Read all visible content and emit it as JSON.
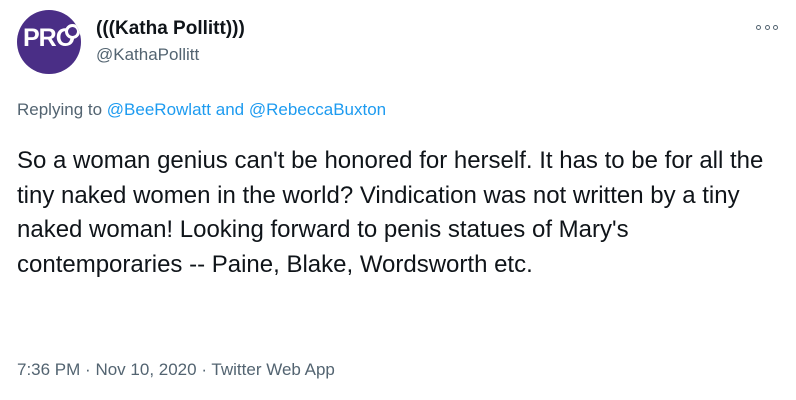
{
  "author": {
    "display_name": "(((Katha Pollitt)))",
    "handle": "@KathaPollitt",
    "avatar_text": "PRO",
    "avatar_color": "#4a2e86"
  },
  "more_icon": "more-horizontal-icon",
  "reply_context": {
    "prefix": "Replying to",
    "users": [
      "@BeeRowlatt",
      "@RebeccaBuxton"
    ],
    "conjunction": "and"
  },
  "tweet_text": "So a woman genius can't be honored for herself. It has to be for all the tiny naked women in the world? Vindication was not written by a tiny naked woman! Looking forward to penis statues of Mary's contemporaries -- Paine, Blake, Wordsworth etc.",
  "meta": {
    "time": "7:36 PM",
    "date": "Nov 10, 2020",
    "separator": "·",
    "source": "Twitter Web App"
  },
  "colors": {
    "link": "#1d9bf0",
    "secondary_text": "#536471",
    "primary_text": "#0f1419"
  }
}
